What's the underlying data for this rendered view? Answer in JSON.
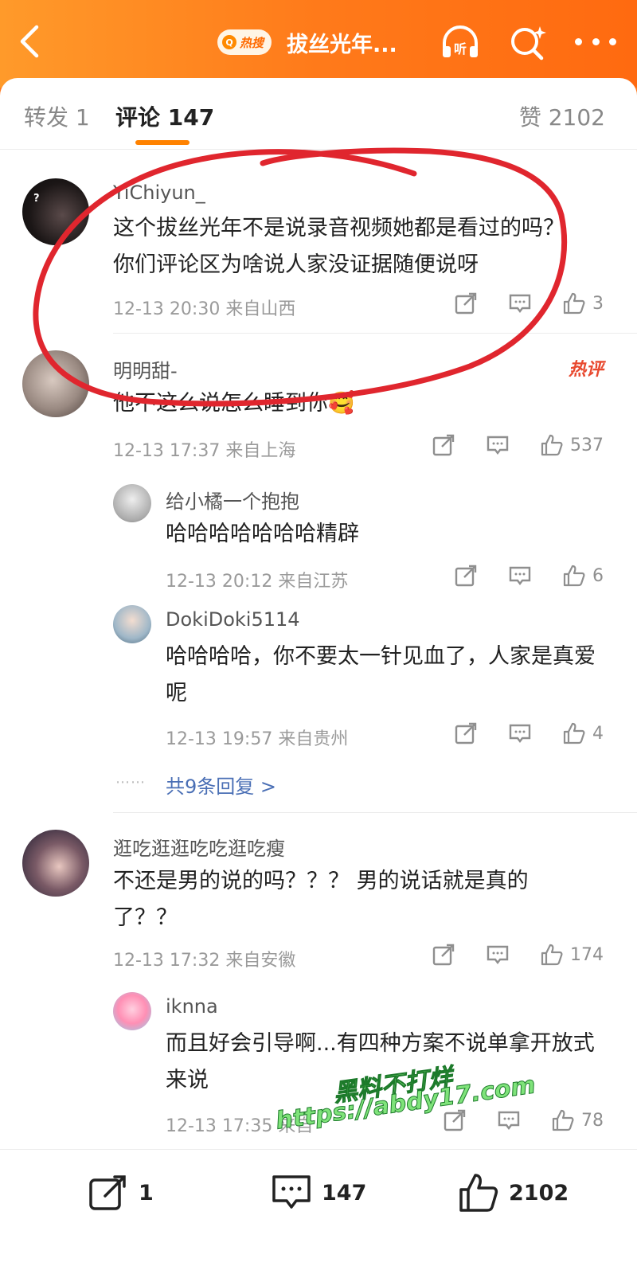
{
  "header": {
    "hot_icon_text": "Q",
    "hot_badge": "热搜",
    "title": "拔丝光年...",
    "listen_label": "听"
  },
  "tabs": {
    "repost": "转发 1",
    "comment": "评论 147",
    "like": "赞 2102"
  },
  "comments": [
    {
      "name": "YiChiyun_",
      "text": "这个拔丝光年不是说录音视频她都是看过的吗？你们评论区为啥说人家没证据随便说呀",
      "time": "12-13 20:30 来自山西",
      "likes": "3"
    },
    {
      "name": "明明甜-",
      "badge": "热评",
      "text": "他不这么说怎么睡到你",
      "emoji": "🥰",
      "time": "12-13 17:37 来自上海",
      "likes": "537",
      "replies": [
        {
          "name": "给小橘一个抱抱",
          "text": "哈哈哈哈哈哈哈精辟",
          "time": "12-13 20:12 来自江苏",
          "likes": "6"
        },
        {
          "name": "DokiDoki5114",
          "text": "哈哈哈哈，你不要太一针见血了，人家是真爱呢",
          "time": "12-13 19:57 来自贵州",
          "likes": "4"
        }
      ],
      "more_replies": "共9条回复 >",
      "dots": "⋯⋯"
    },
    {
      "name": "逛吃逛逛吃吃逛吃瘦",
      "text": "不还是男的说的吗？？？ 男的说话就是真的了？？",
      "time": "12-13 17:32 来自安徽",
      "likes": "174",
      "replies": [
        {
          "name": "iknna",
          "text": "而且好会引导啊...有四种方案不说单拿开放式来说",
          "time": "12-13 17:35 来自",
          "likes": "78"
        }
      ]
    }
  ],
  "bottom": {
    "repost_count": "1",
    "comment_count": "147",
    "like_count": "2102"
  },
  "watermark": {
    "line1": "黑料不打烊",
    "line2": "https://abdy17.com"
  },
  "colors": {
    "header": "#ff7a1a",
    "accent": "#ff8200",
    "link": "#4a6fb5",
    "annotation": "#e0262e",
    "watermark": "#7fe37a"
  }
}
